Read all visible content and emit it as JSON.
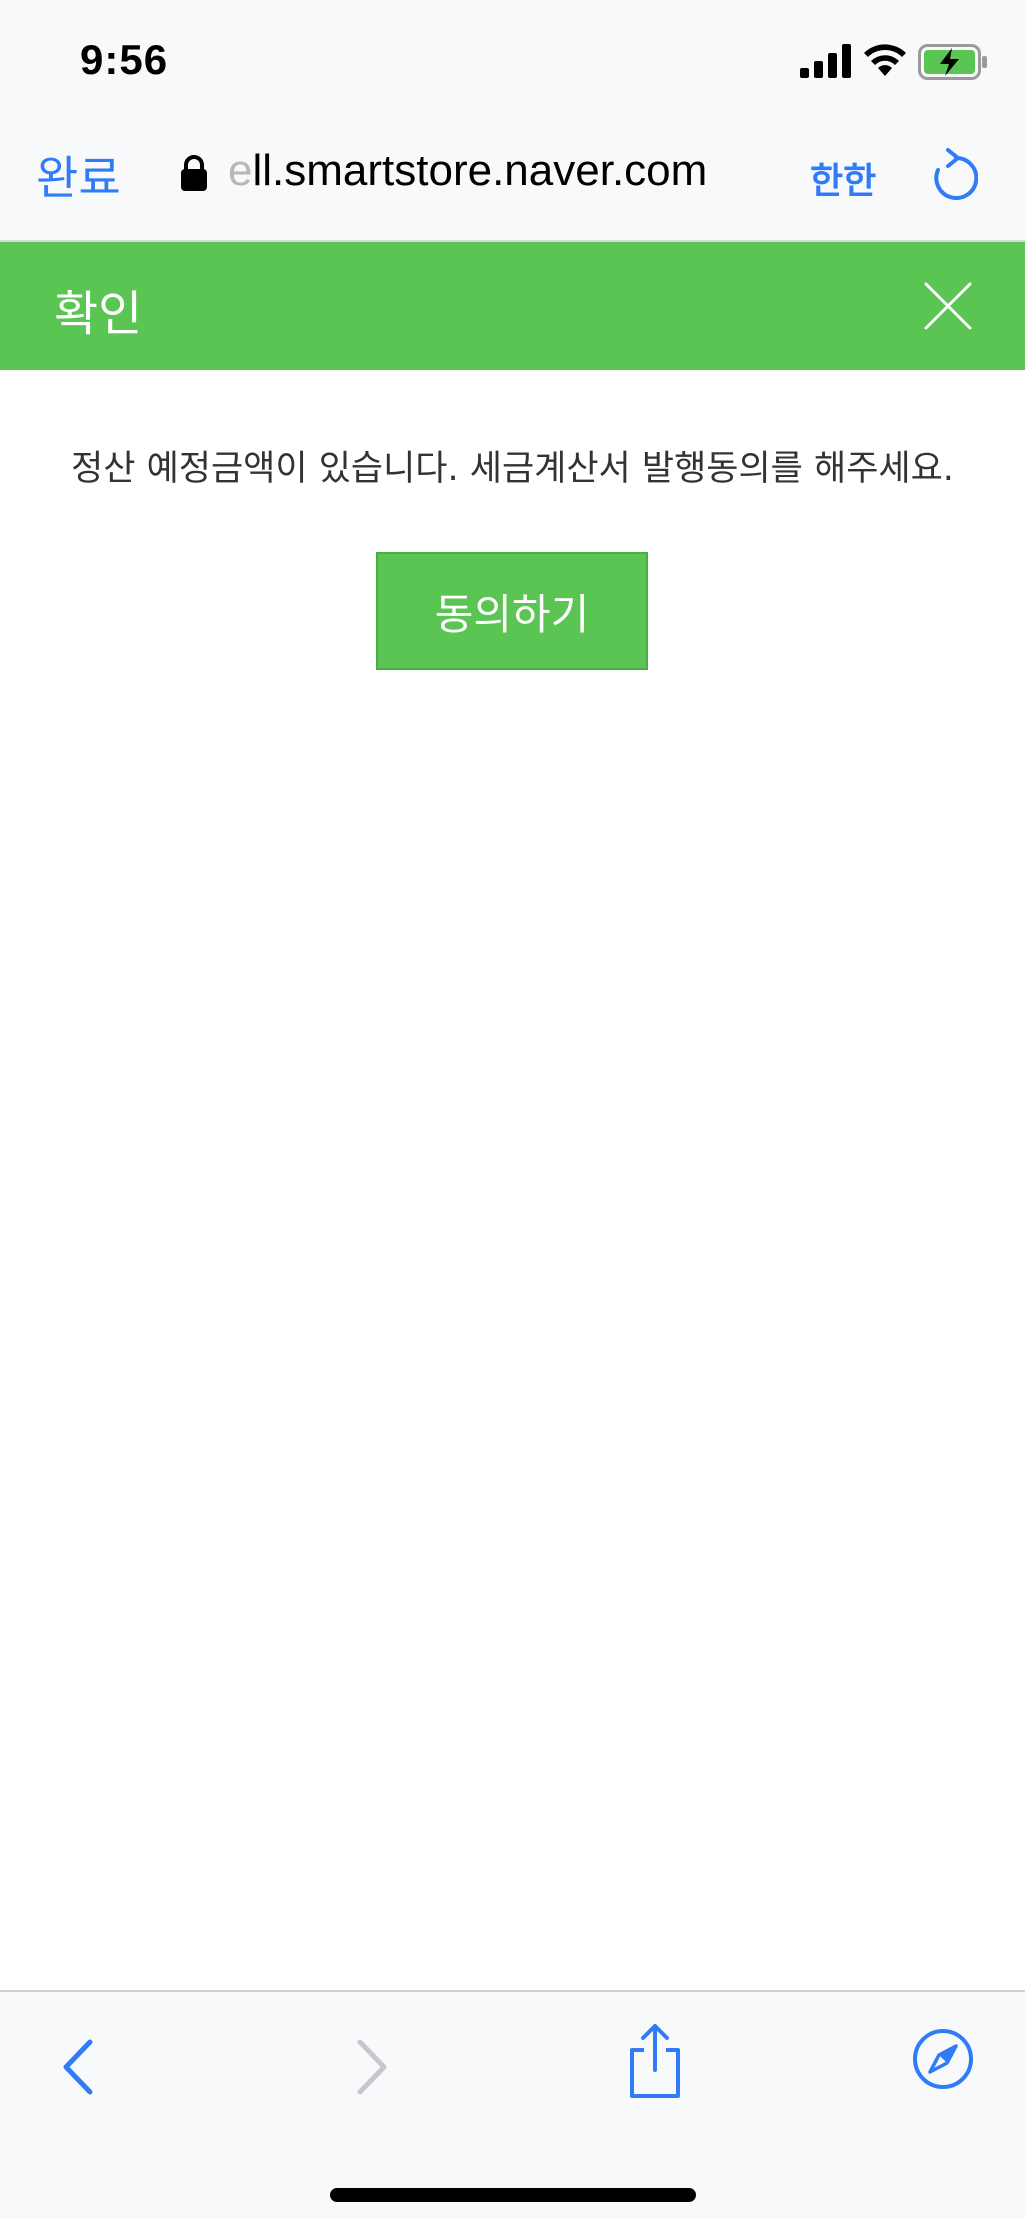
{
  "status_bar": {
    "time": "9:56",
    "signal_icon": "cellular-signal-icon",
    "wifi_icon": "wifi-icon",
    "battery_icon": "battery-charging-icon"
  },
  "browser_toolbar": {
    "done_label": "완료",
    "url_fade": "e",
    "url": "ll.smartstore.naver.com",
    "translate_label": "한한",
    "lock_icon": "lock-icon",
    "reload_icon": "reload-icon"
  },
  "dialog": {
    "title": "확인",
    "close_icon": "close-icon",
    "message": "정산 예정금액이 있습니다. 세금계산서 발행동의를 해주세요.",
    "agree_label": "동의하기"
  },
  "bottom_toolbar": {
    "back_icon": "back-chevron-icon",
    "forward_icon": "forward-chevron-icon",
    "share_icon": "share-icon",
    "compass_icon": "safari-compass-icon"
  },
  "colors": {
    "accent_blue": "#2f7cf6",
    "header_green": "#5bc553",
    "toolbar_bg": "#f8f9fb",
    "disabled_gray": "#c7c7cc"
  }
}
